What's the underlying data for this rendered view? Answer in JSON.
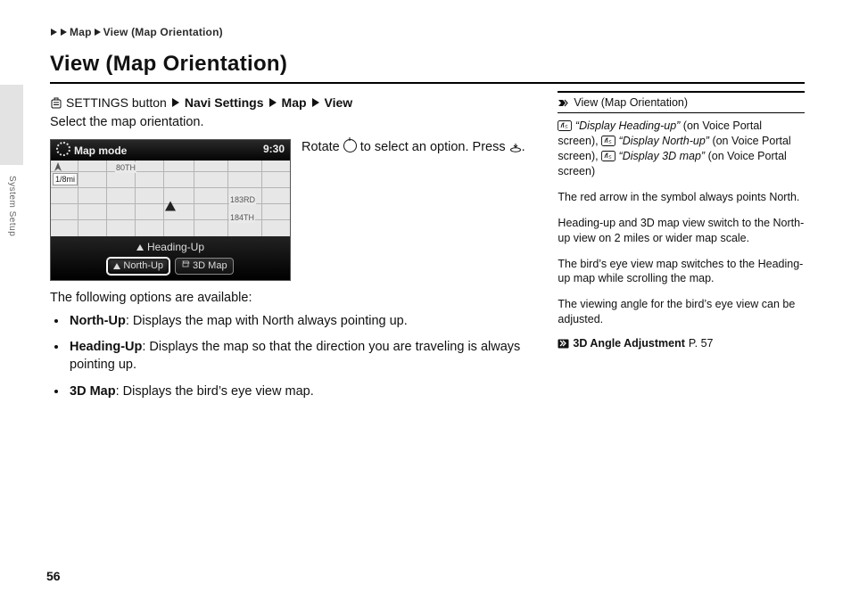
{
  "running_head": {
    "seg1": "Map",
    "seg2": "View (Map Orientation)"
  },
  "title": "View (Map Orientation)",
  "side_tab": "System Setup",
  "nav_path": {
    "settings_button": "SETTINGS button",
    "s1": "Navi Settings",
    "s2": "Map",
    "s3": "View"
  },
  "intro": "Select the map orientation.",
  "screen": {
    "mode_label": "Map mode",
    "clock": "9:30",
    "scale": "1/8mi",
    "street_80": "80TH",
    "street_183": "183RD",
    "street_184": "184TH",
    "heading_up": "Heading-Up",
    "opt_north": "North-Up",
    "opt_3d": "3D Map"
  },
  "instruction": {
    "p1a": "Rotate ",
    "p1b": " to select an option. Press ",
    "p1c": "."
  },
  "options_intro": "The following options are available:",
  "options": [
    {
      "name": "North-Up",
      "desc": ": Displays the map with North always pointing up."
    },
    {
      "name": "Heading-Up",
      "desc": ": Displays the map so that the direction you are traveling is always pointing up."
    },
    {
      "name": "3D Map",
      "desc": ": Displays the bird’s eye view map."
    }
  ],
  "side": {
    "head": "View (Map Orientation)",
    "v1": "“Display Heading-up”",
    "v1_ctx": " (on Voice Portal screen), ",
    "v2": "“Display North-up”",
    "v2_ctx": " (on Voice Portal screen), ",
    "v3": "“Display 3D map”",
    "v3_ctx": " (on Voice Portal screen)",
    "p1": "The red arrow in the symbol always points North.",
    "p2": "Heading-up and 3D map view switch to the North-up view on 2 miles or wider map scale.",
    "p3": "The bird’s eye view map switches to the Heading-up map while scrolling the map.",
    "p4": "The viewing angle for the bird’s eye view can be adjusted.",
    "xref_label": "3D Angle Adjustment",
    "xref_page": " P. 57"
  },
  "page_number": "56"
}
